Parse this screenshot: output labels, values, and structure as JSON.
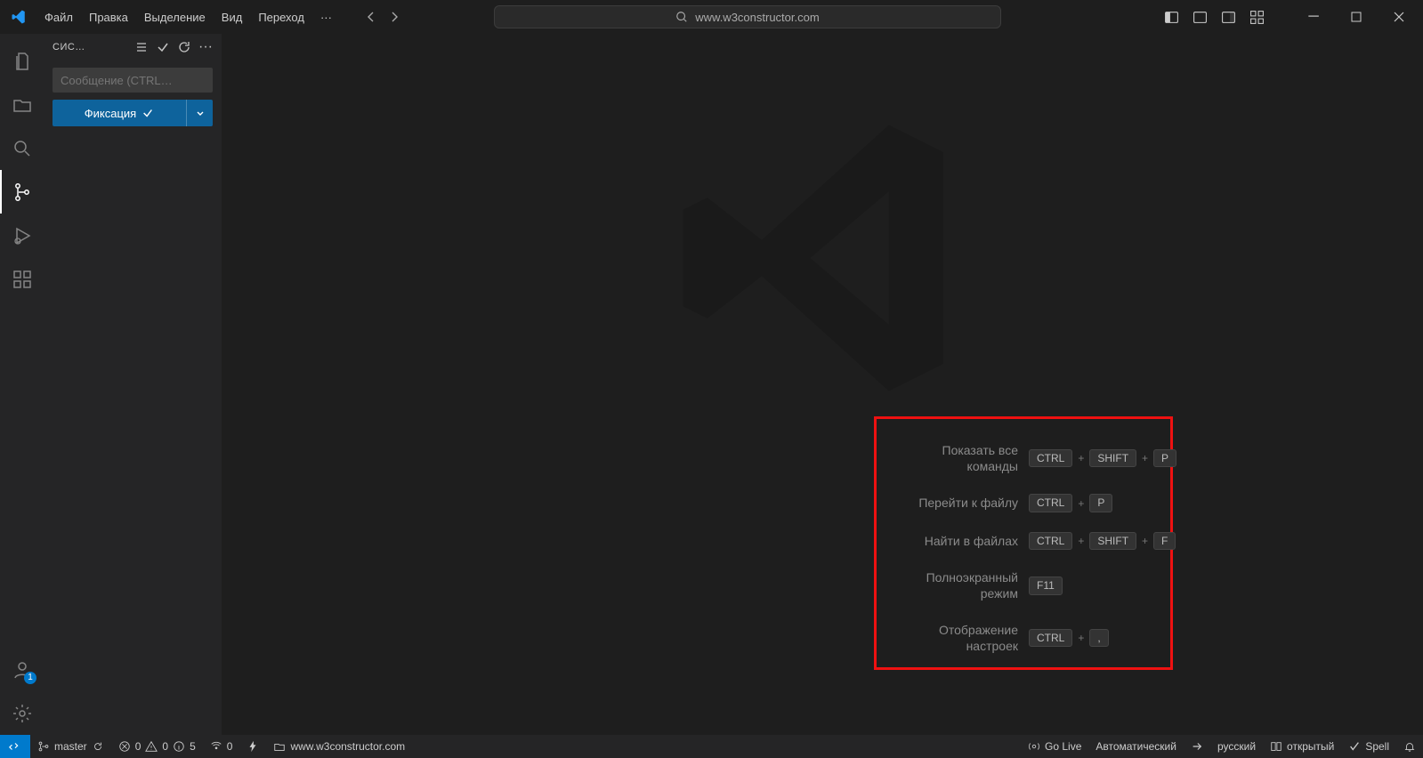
{
  "menu": {
    "file": "Файл",
    "edit": "Правка",
    "selection": "Выделение",
    "view": "Вид",
    "go": "Переход"
  },
  "search": {
    "placeholder": "www.w3constructor.com"
  },
  "sidebar": {
    "title": "СИС…",
    "commit_placeholder": "Сообщение (CTRL…",
    "commit_label": "Фиксация"
  },
  "accounts_badge": "1",
  "shortcuts": [
    {
      "label": "Показать все команды",
      "keys": [
        "CTRL",
        "+",
        "SHIFT",
        "+",
        "P"
      ]
    },
    {
      "label": "Перейти к файлу",
      "keys": [
        "CTRL",
        "+",
        "P"
      ]
    },
    {
      "label": "Найти в файлах",
      "keys": [
        "CTRL",
        "+",
        "SHIFT",
        "+",
        "F"
      ]
    },
    {
      "label": "Полноэкранный режим",
      "keys": [
        "F11"
      ]
    },
    {
      "label": "Отображение настроек",
      "keys": [
        "CTRL",
        "+",
        ","
      ]
    }
  ],
  "status": {
    "branch": "master",
    "errors": "0",
    "warnings": "0",
    "infos": "5",
    "ports": "0",
    "path": "www.w3constructor.com",
    "golive": "Go Live",
    "auto": "Автоматический",
    "lang": "русский",
    "open": "открытый",
    "spell": "Spell"
  }
}
